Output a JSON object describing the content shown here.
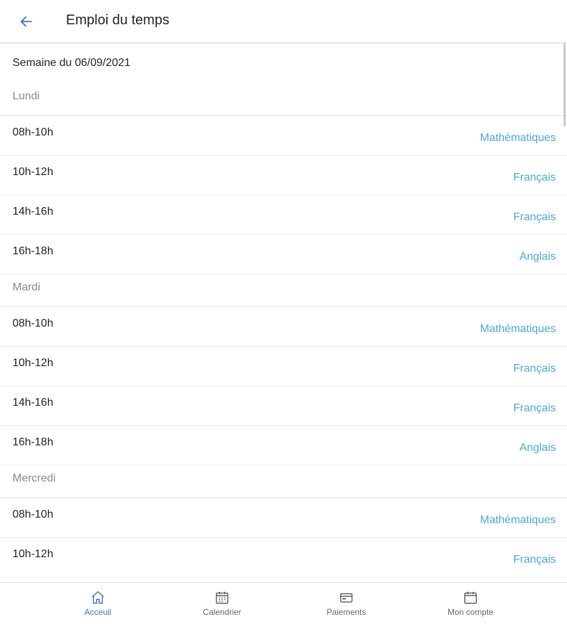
{
  "header": {
    "title": "Emploi du temps",
    "back_icon": "arrow-left-icon"
  },
  "week_label": "Semaine du 06/09/2021",
  "days": [
    {
      "name": "Lundi",
      "slots": [
        {
          "time": "08h-10h",
          "subject": "Mathématiques"
        },
        {
          "time": "10h-12h",
          "subject": "Français"
        },
        {
          "time": "14h-16h",
          "subject": "Français"
        },
        {
          "time": "16h-18h",
          "subject": "Anglais"
        }
      ]
    },
    {
      "name": "Mardi",
      "slots": [
        {
          "time": "08h-10h",
          "subject": "Mathématiques"
        },
        {
          "time": "10h-12h",
          "subject": "Français"
        },
        {
          "time": "14h-16h",
          "subject": "Français"
        },
        {
          "time": "16h-18h",
          "subject": "Anglais"
        }
      ]
    },
    {
      "name": "Mercredi",
      "slots": [
        {
          "time": "08h-10h",
          "subject": "Mathématiques"
        },
        {
          "time": "10h-12h",
          "subject": "Français"
        }
      ]
    }
  ],
  "bottom_nav": [
    {
      "label": "Acceuil",
      "icon": "home-icon",
      "active": true
    },
    {
      "label": "Calendrier",
      "icon": "calendar-icon",
      "active": false
    },
    {
      "label": "Paiements",
      "icon": "payment-card-icon",
      "active": false
    },
    {
      "label": "Mon compte",
      "icon": "account-icon",
      "active": false
    }
  ],
  "colors": {
    "accent": "#3c6fd2",
    "subject": "#4aa8d8",
    "muted": "#8a8a8a"
  }
}
